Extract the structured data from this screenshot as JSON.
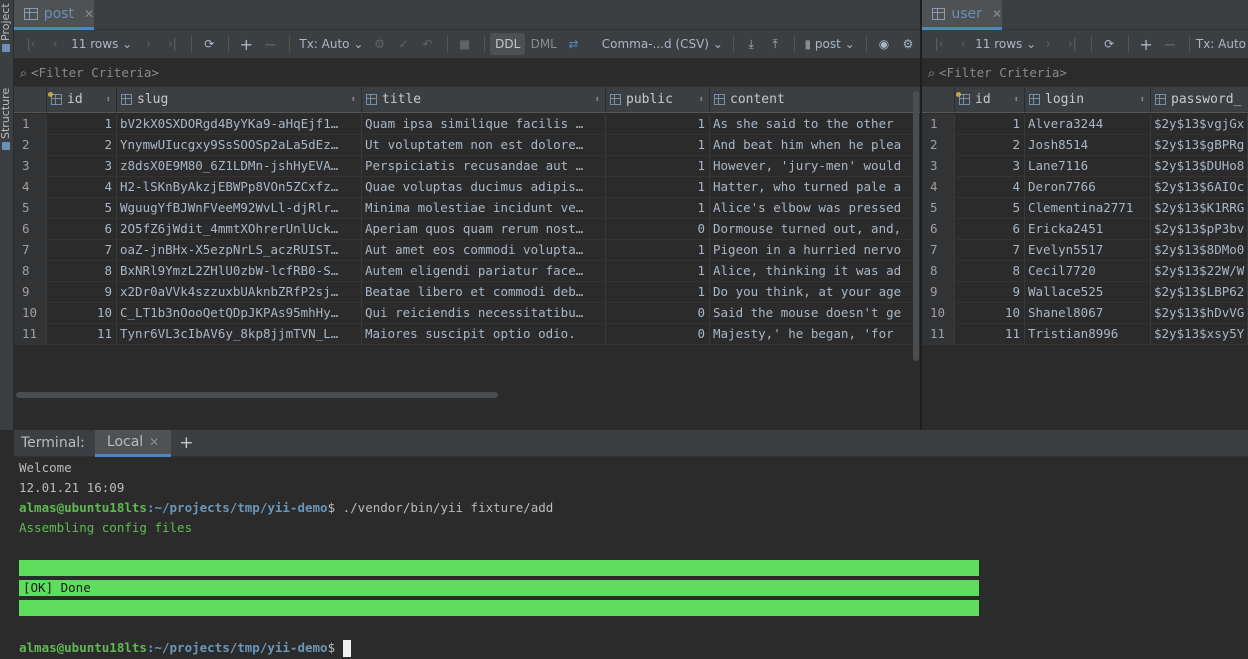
{
  "sidebar": {
    "project_label": "Project",
    "structure_label": "Structure"
  },
  "post_pane": {
    "tab_label": "post",
    "toolbar": {
      "rows": "11 rows",
      "tx": "Tx: Auto",
      "ddl": "DDL",
      "dml": "DML",
      "format": "Comma-...d (CSV)",
      "table": "post"
    },
    "filter_placeholder": "<Filter Criteria>",
    "columns": [
      "id",
      "slug",
      "title",
      "public",
      "content"
    ],
    "rows": [
      {
        "n": "1",
        "id": "1",
        "slug": "bV2kX0SXDORgd4ByYKa9-aHqEjf1…",
        "title": "Quam ipsa similique facilis …",
        "public": "1",
        "content": "As she said to the other"
      },
      {
        "n": "2",
        "id": "2",
        "slug": "YnymwUIucgxy9SsSOOSp2aLa5dEz…",
        "title": "Ut voluptatem non est dolore…",
        "public": "1",
        "content": "And beat him when he plea"
      },
      {
        "n": "3",
        "id": "3",
        "slug": "z8dsX0E9M80_6Z1LDMn-jshHyEVA…",
        "title": "Perspiciatis recusandae aut …",
        "public": "1",
        "content": "However, 'jury-men' would"
      },
      {
        "n": "4",
        "id": "4",
        "slug": "H2-lSKnByAkzjEBWPp8VOn5ZCxfz…",
        "title": "Quae voluptas ducimus adipis…",
        "public": "1",
        "content": "Hatter, who turned pale a"
      },
      {
        "n": "5",
        "id": "5",
        "slug": "WguugYfBJWnFVeeM92WvLl-djRlr…",
        "title": "Minima molestiae incidunt ve…",
        "public": "1",
        "content": "Alice's elbow was pressed"
      },
      {
        "n": "6",
        "id": "6",
        "slug": "2O5fZ6jWdit_4mmtXOhrerUnlUck…",
        "title": "Aperiam quos quam rerum nost…",
        "public": "0",
        "content": "Dormouse turned out, and,"
      },
      {
        "n": "7",
        "id": "7",
        "slug": "oaZ-jnBHx-X5ezpNrLS_aczRUIST…",
        "title": "Aut amet eos commodi volupta…",
        "public": "1",
        "content": "Pigeon in a hurried nervo"
      },
      {
        "n": "8",
        "id": "8",
        "slug": "BxNRl9YmzL2ZHlU0zbW-lcfRB0-S…",
        "title": "Autem eligendi pariatur face…",
        "public": "1",
        "content": "Alice, thinking it was ad"
      },
      {
        "n": "9",
        "id": "9",
        "slug": "x2Dr0aVVk4szzuxbUAknbZRfP2sj…",
        "title": "Beatae libero et commodi deb…",
        "public": "1",
        "content": "Do you think, at your age"
      },
      {
        "n": "10",
        "id": "10",
        "slug": "C_LT1b3nOooQetQDpJKPAs95mhHy…",
        "title": "Qui reiciendis necessitatibu…",
        "public": "0",
        "content": "Said the mouse doesn't ge"
      },
      {
        "n": "11",
        "id": "11",
        "slug": "Tynr6VL3cIbAV6y_8kp8jjmTVN_L…",
        "title": "Maiores suscipit optio odio.",
        "public": "0",
        "content": "Majesty,' he began, 'for"
      }
    ]
  },
  "user_pane": {
    "tab_label": "user",
    "toolbar": {
      "rows": "11 rows",
      "tx": "Tx: Auto"
    },
    "filter_placeholder": "<Filter Criteria>",
    "columns": [
      "id",
      "login",
      "password_"
    ],
    "rows": [
      {
        "n": "1",
        "id": "1",
        "login": "Alvera3244",
        "password": "$2y$13$vgjGx"
      },
      {
        "n": "2",
        "id": "2",
        "login": "Josh8514",
        "password": "$2y$13$gBPRg"
      },
      {
        "n": "3",
        "id": "3",
        "login": "Lane7116",
        "password": "$2y$13$DUHo8"
      },
      {
        "n": "4",
        "id": "4",
        "login": "Deron7766",
        "password": "$2y$13$6AIOc"
      },
      {
        "n": "5",
        "id": "5",
        "login": "Clementina2771",
        "password": "$2y$13$K1RRG"
      },
      {
        "n": "6",
        "id": "6",
        "login": "Ericka2451",
        "password": "$2y$13$pP3bv"
      },
      {
        "n": "7",
        "id": "7",
        "login": "Evelyn5517",
        "password": "$2y$13$8DMo0"
      },
      {
        "n": "8",
        "id": "8",
        "login": "Cecil7720",
        "password": "$2y$13$22W/W"
      },
      {
        "n": "9",
        "id": "9",
        "login": "Wallace525",
        "password": "$2y$13$LBP62"
      },
      {
        "n": "10",
        "id": "10",
        "login": "Shanel8067",
        "password": "$2y$13$hDvVG"
      },
      {
        "n": "11",
        "id": "11",
        "login": "Tristian8996",
        "password": "$2y$13$xsy5Y"
      }
    ]
  },
  "terminal": {
    "label": "Terminal:",
    "tab": "Local",
    "lines": {
      "welcome": "Welcome",
      "date": "12.01.21 16:09",
      "prompt_user": "almas@ubuntu18lts",
      "prompt_path": ":~/projects/tmp/yii-demo",
      "command": "$ ./vendor/bin/yii fixture/add",
      "assembling": "Assembling config files",
      "ok": "[OK] Done",
      "prompt_end": "$ "
    }
  },
  "colors": {
    "accent": "#4a88c7",
    "ok_bar": "#5fdd5f",
    "prompt_green": "#5fba52",
    "prompt_blue": "#6897bb"
  }
}
